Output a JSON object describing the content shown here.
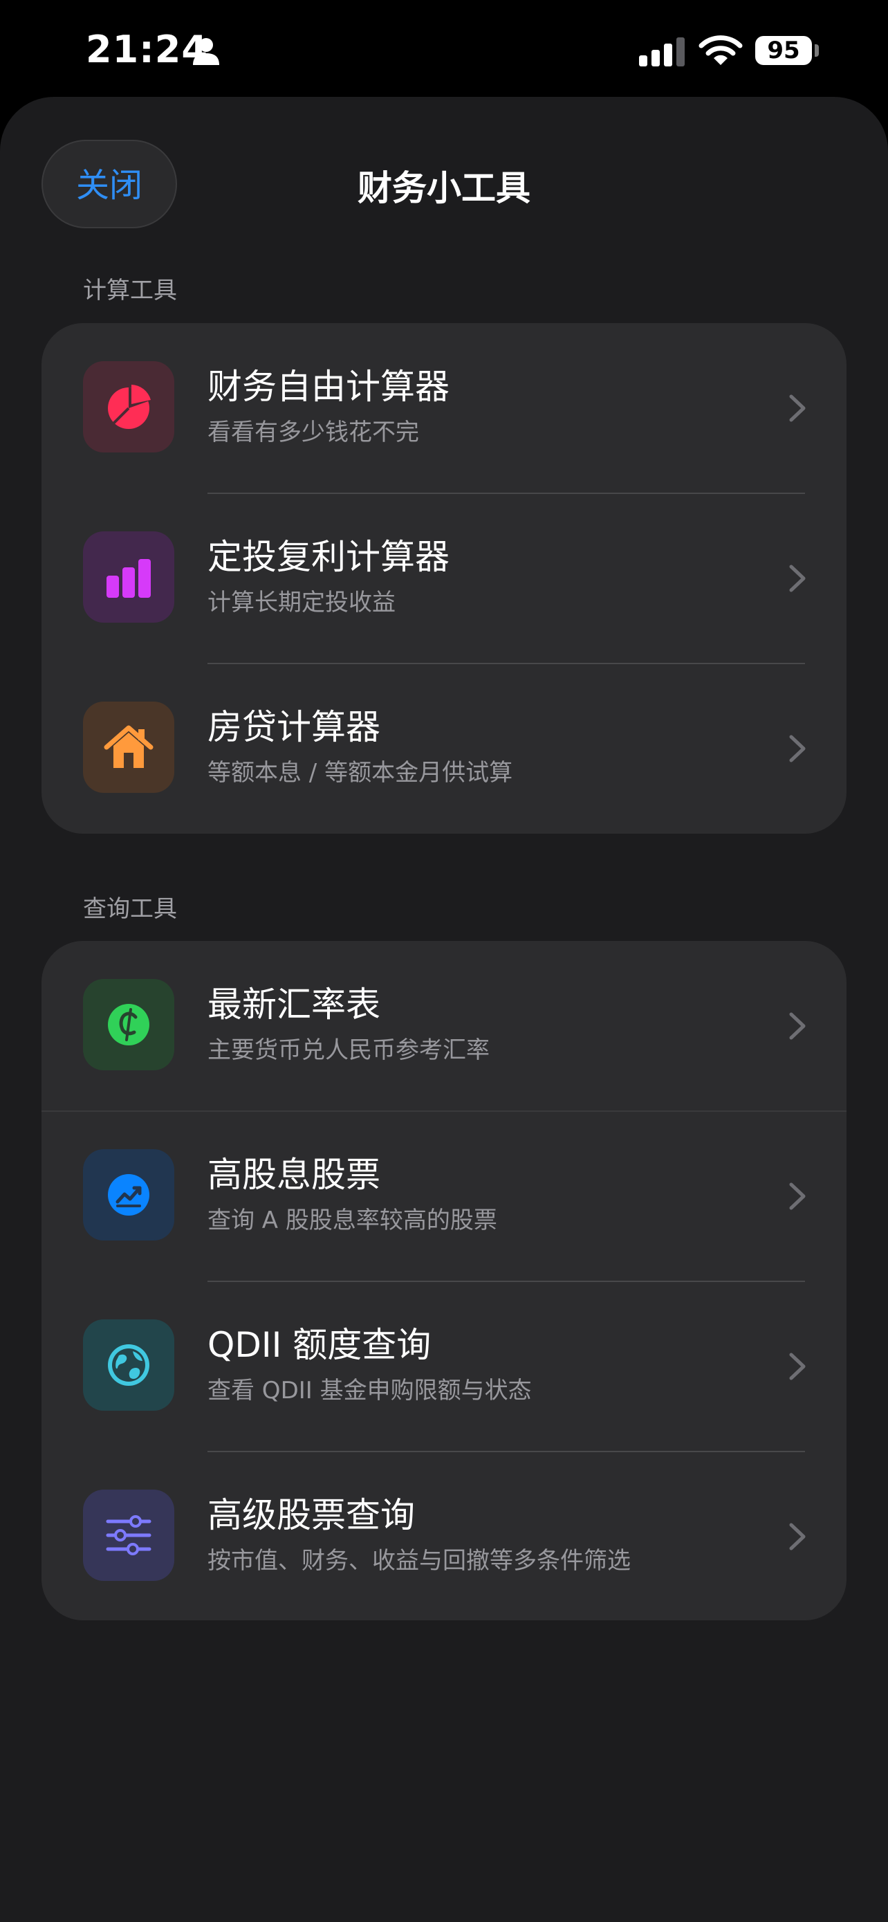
{
  "status_bar": {
    "time": "21:24",
    "battery": "95",
    "icons": [
      "person-icon",
      "signal-icon",
      "wifi-icon",
      "battery-icon"
    ]
  },
  "header": {
    "close_label": "关闭",
    "title": "财务小工具"
  },
  "sections": [
    {
      "label": "计算工具",
      "items": [
        {
          "title": "财务自由计算器",
          "subtitle": "看看有多少钱花不完",
          "icon": "pie-chart-icon",
          "color": "#ff2d55"
        },
        {
          "title": "定投复利计算器",
          "subtitle": "计算长期定投收益",
          "icon": "bar-chart-icon",
          "color": "#d63af9"
        },
        {
          "title": "房贷计算器",
          "subtitle": "等额本息 / 等额本金月供试算",
          "icon": "house-icon",
          "color": "#ff9a3c"
        }
      ]
    },
    {
      "label": "查询工具",
      "items": [
        {
          "title": "最新汇率表",
          "subtitle": "主要货币兑人民币参考汇率",
          "icon": "currency-icon",
          "color": "#30d158"
        },
        {
          "title": "高股息股票",
          "subtitle": "查询 A 股股息率较高的股票",
          "icon": "stock-chart-icon",
          "color": "#0a84ff"
        },
        {
          "title": "QDII 额度查询",
          "subtitle": "查看 QDII 基金申购限额与状态",
          "icon": "globe-icon",
          "color": "#40c8e0"
        },
        {
          "title": "高级股票查询",
          "subtitle": "按市值、财务、收益与回撤等多条件筛选",
          "icon": "sliders-icon",
          "color": "#7d7aff"
        }
      ]
    }
  ]
}
